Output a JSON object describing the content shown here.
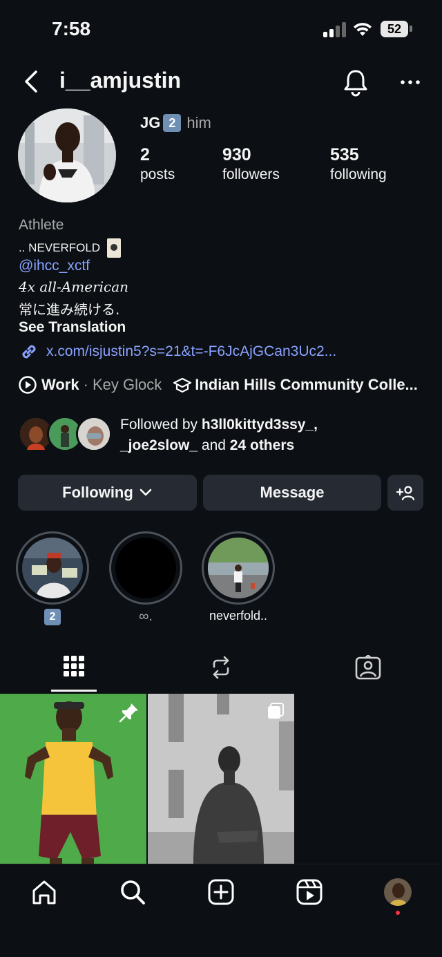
{
  "status_bar": {
    "time": "7:58",
    "battery": "52"
  },
  "header": {
    "username": "i__amjustin"
  },
  "profile": {
    "name": "JG",
    "badge": "2",
    "pronouns": "him",
    "stats": [
      {
        "value": "2",
        "label": "posts"
      },
      {
        "value": "930",
        "label": "followers"
      },
      {
        "value": "535",
        "label": "following"
      }
    ],
    "category": "Athlete",
    "bio_line1": ".. NEVERFOLD",
    "mention": "@ihcc_xctf",
    "bio_italic": "4x all-American",
    "bio_japanese": "常に進み続ける.",
    "see_translation": "See Translation",
    "link": "x.com/isjustin5?s=21&t=-F6JcAjGCan3Uc2...",
    "music_title": "Work",
    "music_sep": "·",
    "music_artist": "Key Glock",
    "school": "Indian Hills Community Colle..."
  },
  "followed_by": {
    "prefix": "Followed by",
    "user1": "h3ll0kittyd3ssy_,",
    "user2": "_joe2slow_",
    "and_text": "and",
    "others": "24 others"
  },
  "actions": {
    "following": "Following",
    "message": "Message"
  },
  "highlights": [
    {
      "label": "2"
    },
    {
      "label": "∞."
    },
    {
      "label": "neverfold.."
    }
  ],
  "colors": {
    "background": "#0c1014",
    "link": "#8aa2ff",
    "button": "#262b33",
    "notification_dot": "#ff3040"
  }
}
